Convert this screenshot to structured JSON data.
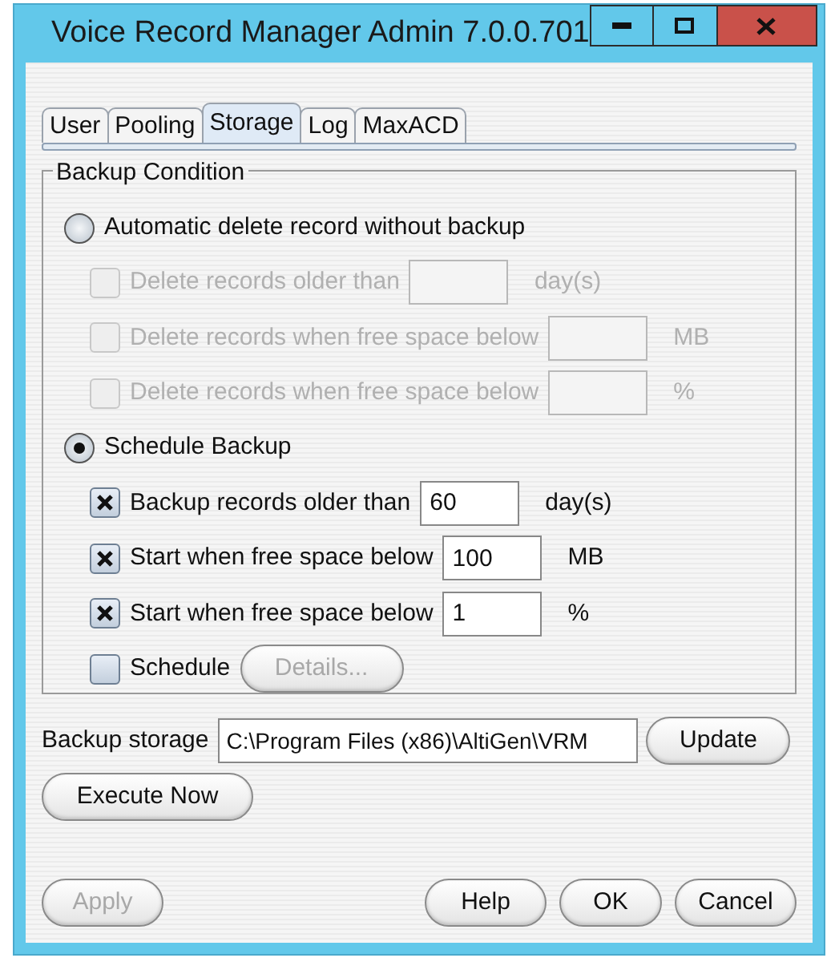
{
  "window": {
    "title": "Voice Record Manager Admin 7.0.0.701"
  },
  "tabs": [
    {
      "label": "User",
      "selected": false
    },
    {
      "label": "Pooling",
      "selected": false
    },
    {
      "label": "Storage",
      "selected": true
    },
    {
      "label": "Log",
      "selected": false
    },
    {
      "label": "MaxACD",
      "selected": false
    }
  ],
  "backup_condition": {
    "title": "Backup Condition",
    "options": [
      {
        "label": "Automatic delete record without backup",
        "selected": false,
        "children": [
          {
            "kind": "field",
            "label": "Delete records older than",
            "checked": false,
            "disabled": true,
            "unit": "day(s)"
          },
          {
            "kind": "field",
            "label": "Delete records when free space below",
            "checked": false,
            "disabled": true,
            "unit": "MB"
          },
          {
            "kind": "field",
            "label": "Delete records when free space below",
            "checked": false,
            "disabled": true,
            "unit": "%"
          }
        ]
      },
      {
        "label": "Schedule Backup",
        "selected": true,
        "children": [
          {
            "kind": "field",
            "label": "Backup records older than",
            "checked": true,
            "disabled": false,
            "value": "60",
            "unit": "day(s)"
          },
          {
            "kind": "field",
            "label": "Start when free space below",
            "checked": true,
            "disabled": false,
            "value": "100",
            "unit": "MB"
          },
          {
            "kind": "field",
            "label": "Start when free space below",
            "checked": true,
            "disabled": false,
            "value": "1",
            "unit": "%"
          },
          {
            "kind": "button",
            "label": "Schedule",
            "checked": false,
            "disabled": false,
            "button": {
              "label": "Details...",
              "disabled": true
            }
          }
        ]
      }
    ]
  },
  "backup_storage": {
    "label": "Backup storage",
    "value": "C:\\Program Files (x86)\\AltiGen\\VRM",
    "button": {
      "label": "Update",
      "disabled": false
    }
  },
  "execute_button": {
    "label": "Execute Now",
    "disabled": false
  },
  "footer_buttons": [
    {
      "label": "Apply",
      "disabled": true
    },
    {
      "label": "Help",
      "disabled": false
    },
    {
      "label": "OK",
      "disabled": false
    },
    {
      "label": "Cancel",
      "disabled": false
    }
  ]
}
